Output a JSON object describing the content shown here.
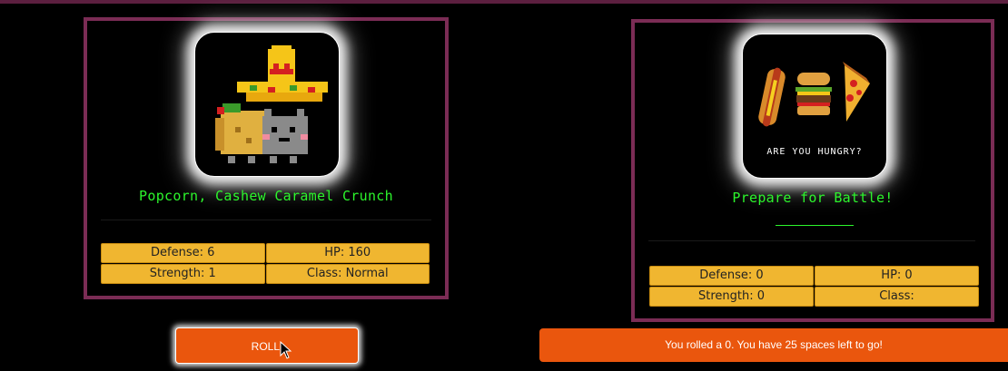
{
  "player": {
    "name": "Popcorn, Cashew Caramel Crunch",
    "portrait_icon": "taco-cat-sombrero-icon",
    "stats": {
      "defense": "Defense: 6",
      "hp": "HP: 160",
      "strength": "Strength: 1",
      "class": "Class: Normal"
    }
  },
  "enemy": {
    "title": "Prepare for Battle!",
    "portrait_icon": "are-you-hungry-food-icon",
    "portrait_caption": "ARE YOU HUNGRY?",
    "stats": {
      "defense": "Defense: 0",
      "hp": "HP: 0",
      "strength": "Strength: 0",
      "class": "Class:"
    }
  },
  "controls": {
    "roll_label": "ROLL!",
    "status_text": "You rolled a 0. You have 25 spaces left to go!"
  },
  "colors": {
    "accent_orange": "#ea560d",
    "card_border": "#7b2c55",
    "stat_bg": "#f0b630",
    "name_green": "#2cf52c"
  }
}
